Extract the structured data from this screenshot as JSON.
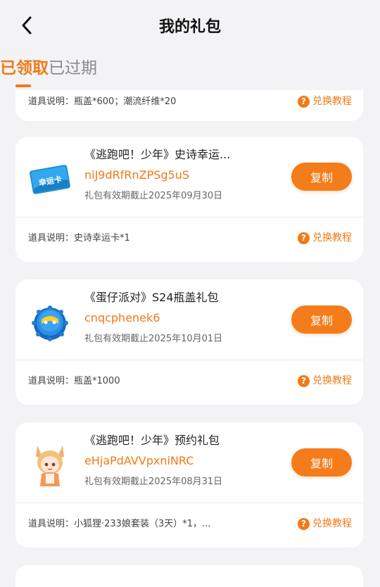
{
  "header": {
    "title": "我的礼包"
  },
  "tabs": [
    {
      "label": "已领取"
    },
    {
      "label": "已过期"
    }
  ],
  "colors": {
    "accent": "#f07a17",
    "background": "#f3f3f6"
  },
  "gifts": [
    {
      "item_desc": "道具说明：瓶盖*600；潮流纤维*20",
      "guide_label": "兑换教程"
    },
    {
      "name": "《逃跑吧！少年》史诗幸运...",
      "code": "niJ9dRfRnZPSg5uS",
      "expiry": "礼包有效期截止2025年09月30日",
      "copy_label": "复制",
      "item_desc": "道具说明：史诗幸运卡*1",
      "guide_label": "兑换教程",
      "icon": "lucky-card-icon",
      "icon_text": "幸运卡"
    },
    {
      "name": "《蛋仔派对》S24瓶盖礼包",
      "code": "cnqcphenek6",
      "expiry": "礼包有效期截止2025年10月01日",
      "copy_label": "复制",
      "item_desc": "道具说明：瓶盖*1000",
      "guide_label": "兑换教程",
      "icon": "bottle-cap-icon"
    },
    {
      "name": "《逃跑吧！少年》预约礼包",
      "code": "eHjaPdAVVpxniNRC",
      "expiry": "礼包有效期截止2025年08月31日",
      "copy_label": "复制",
      "item_desc": "道具说明：小狐狸·233娘套装（3天）*1，...",
      "guide_label": "兑换教程",
      "icon": "fox-girl-avatar-icon"
    }
  ]
}
